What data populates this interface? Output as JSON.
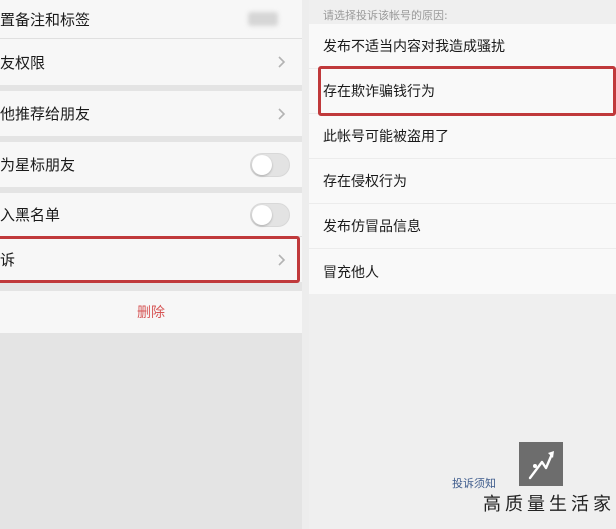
{
  "settings": {
    "remark_label": "置备注和标签",
    "permissions_label": "友权限",
    "recommend_label": "他推荐给朋友",
    "star_label": "为星标朋友",
    "blacklist_label": "入黑名单",
    "complain_label": "诉",
    "delete_label": "删除"
  },
  "report": {
    "hint": "请选择投诉该帐号的原因:",
    "reasons": [
      "发布不适当内容对我造成骚扰",
      "存在欺诈骗钱行为",
      "此帐号可能被盗用了",
      "存在侵权行为",
      "发布仿冒品信息",
      "冒充他人"
    ],
    "notice": "投诉须知"
  },
  "watermark": {
    "brand": "高质量生活家"
  },
  "colors": {
    "highlight": "#c0393b",
    "delete_text": "#d65656",
    "link": "#3d5b8c"
  }
}
